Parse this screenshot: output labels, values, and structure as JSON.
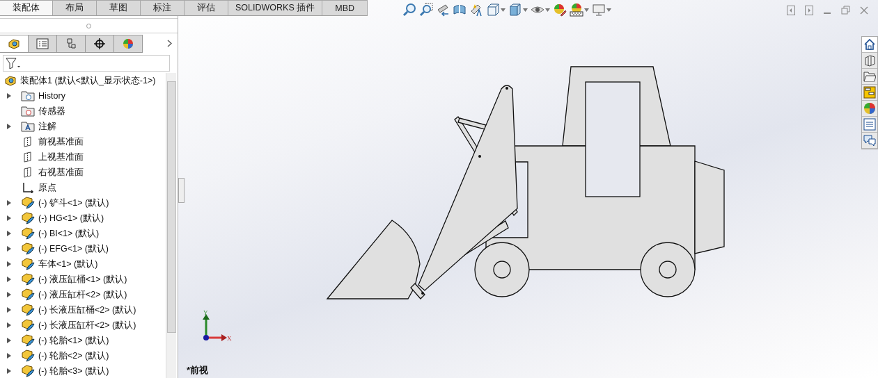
{
  "command_tabs": [
    {
      "label": "装配体",
      "selected": true
    },
    {
      "label": "布局",
      "selected": false
    },
    {
      "label": "草图",
      "selected": false
    },
    {
      "label": "标注",
      "selected": false
    },
    {
      "label": "评估",
      "selected": false
    },
    {
      "label": "SOLIDWORKS 插件",
      "selected": false
    },
    {
      "label": "MBD",
      "selected": false
    }
  ],
  "panel_tabs": [
    {
      "kind": "feature",
      "selected": true
    },
    {
      "kind": "property",
      "selected": false
    },
    {
      "kind": "config",
      "selected": false
    },
    {
      "kind": "dimxpert",
      "selected": false
    },
    {
      "kind": "display",
      "selected": false
    }
  ],
  "tree": {
    "root": "装配体1  (默认<默认_显示状态-1>)",
    "items": [
      {
        "kind": "history",
        "label": "History",
        "expandable": true
      },
      {
        "kind": "sensor",
        "label": "传感器",
        "expandable": false
      },
      {
        "kind": "annotation",
        "label": "注解",
        "expandable": true
      },
      {
        "kind": "plane",
        "label": "前视基准面",
        "expandable": false
      },
      {
        "kind": "plane",
        "label": "上视基准面",
        "expandable": false
      },
      {
        "kind": "plane",
        "label": "右视基准面",
        "expandable": false
      },
      {
        "kind": "origin",
        "label": "原点",
        "expandable": false
      },
      {
        "kind": "component",
        "label": "(-) 铲斗<1> (默认)",
        "expandable": true
      },
      {
        "kind": "component",
        "label": "(-) HG<1> (默认)",
        "expandable": true
      },
      {
        "kind": "component",
        "label": "(-) BI<1> (默认)",
        "expandable": true
      },
      {
        "kind": "component",
        "label": "(-) EFG<1> (默认)",
        "expandable": true
      },
      {
        "kind": "component",
        "label": "车体<1> (默认)",
        "expandable": true
      },
      {
        "kind": "component",
        "label": "(-) 液压缸桶<1> (默认)",
        "expandable": true
      },
      {
        "kind": "component",
        "label": "(-) 液压缸杆<2> (默认)",
        "expandable": true
      },
      {
        "kind": "component",
        "label": "(-) 长液压缸桶<2> (默认)",
        "expandable": true
      },
      {
        "kind": "component",
        "label": "(-) 长液压缸杆<2> (默认)",
        "expandable": true
      },
      {
        "kind": "component",
        "label": "(-) 轮胎<1> (默认)",
        "expandable": true
      },
      {
        "kind": "component",
        "label": "(-) 轮胎<2> (默认)",
        "expandable": true
      },
      {
        "kind": "component",
        "label": "(-) 轮胎<3> (默认)",
        "expandable": true
      }
    ]
  },
  "view_toolbar": [
    {
      "kind": "zoom-fit",
      "dropdown": false
    },
    {
      "kind": "zoom-area",
      "dropdown": false
    },
    {
      "kind": "previous-view",
      "dropdown": false
    },
    {
      "kind": "section",
      "dropdown": false
    },
    {
      "kind": "dynamic-annotation",
      "dropdown": false
    },
    {
      "kind": "view-orientation",
      "dropdown": true
    },
    {
      "kind": "display-style",
      "dropdown": true
    },
    {
      "kind": "hide-show",
      "dropdown": true
    },
    {
      "kind": "edit-appearance",
      "dropdown": false
    },
    {
      "kind": "scene",
      "dropdown": true
    },
    {
      "kind": "view-settings",
      "dropdown": true
    }
  ],
  "task_pane": [
    {
      "kind": "home"
    },
    {
      "kind": "parts"
    },
    {
      "kind": "folder"
    },
    {
      "kind": "properties"
    },
    {
      "kind": "appearance"
    },
    {
      "kind": "list"
    },
    {
      "kind": "comments"
    }
  ],
  "triad": {
    "y_label": "Y",
    "x_label": "X"
  },
  "view_name": "*前视"
}
